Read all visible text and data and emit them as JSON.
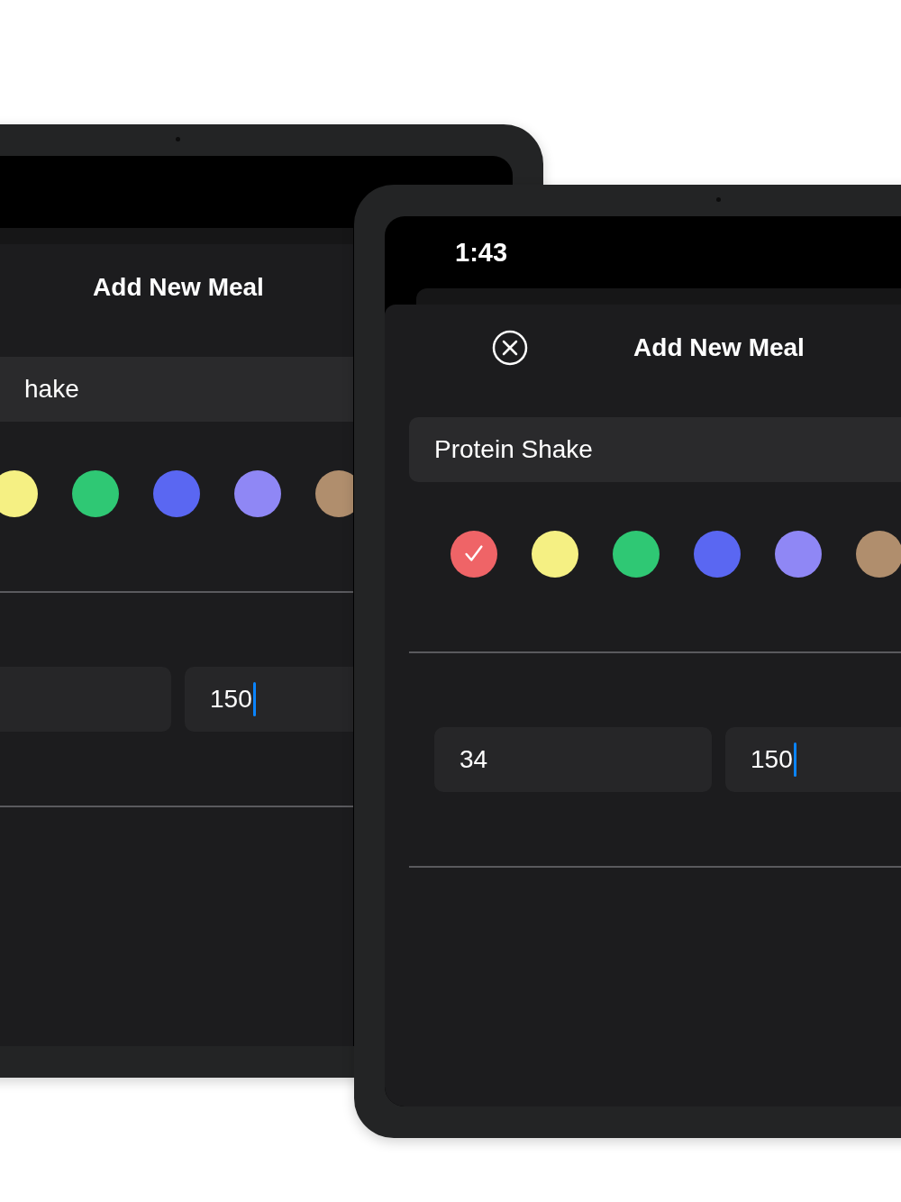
{
  "devices": [
    {
      "kind": "back",
      "title": "Add New Meal",
      "name_field": {
        "value": "hake"
      },
      "colors": [
        {
          "color": "#f5f083",
          "selected": false
        },
        {
          "color": "#2fc874",
          "selected": false
        },
        {
          "color": "#5a67f2",
          "selected": false
        },
        {
          "color": "#8f87f5",
          "selected": false
        },
        {
          "color": "#b08e6d",
          "selected": false
        }
      ],
      "fields": [
        {
          "focused": false
        },
        {
          "value": "150",
          "focused": true
        }
      ]
    },
    {
      "kind": "front",
      "status_time": "1:43",
      "close_button": true,
      "title": "Add New Meal",
      "name_field": {
        "value": "Protein Shake"
      },
      "colors": [
        {
          "color": "#ef6467",
          "selected": true
        },
        {
          "color": "#f5f083",
          "selected": false
        },
        {
          "color": "#2fc874",
          "selected": false
        },
        {
          "color": "#5a67f2",
          "selected": false
        },
        {
          "color": "#8f87f5",
          "selected": false
        },
        {
          "color": "#b08e6d",
          "selected": false
        }
      ],
      "fields": [
        {
          "value": "34",
          "focused": false
        },
        {
          "value": "150",
          "focused": true
        }
      ]
    }
  ]
}
